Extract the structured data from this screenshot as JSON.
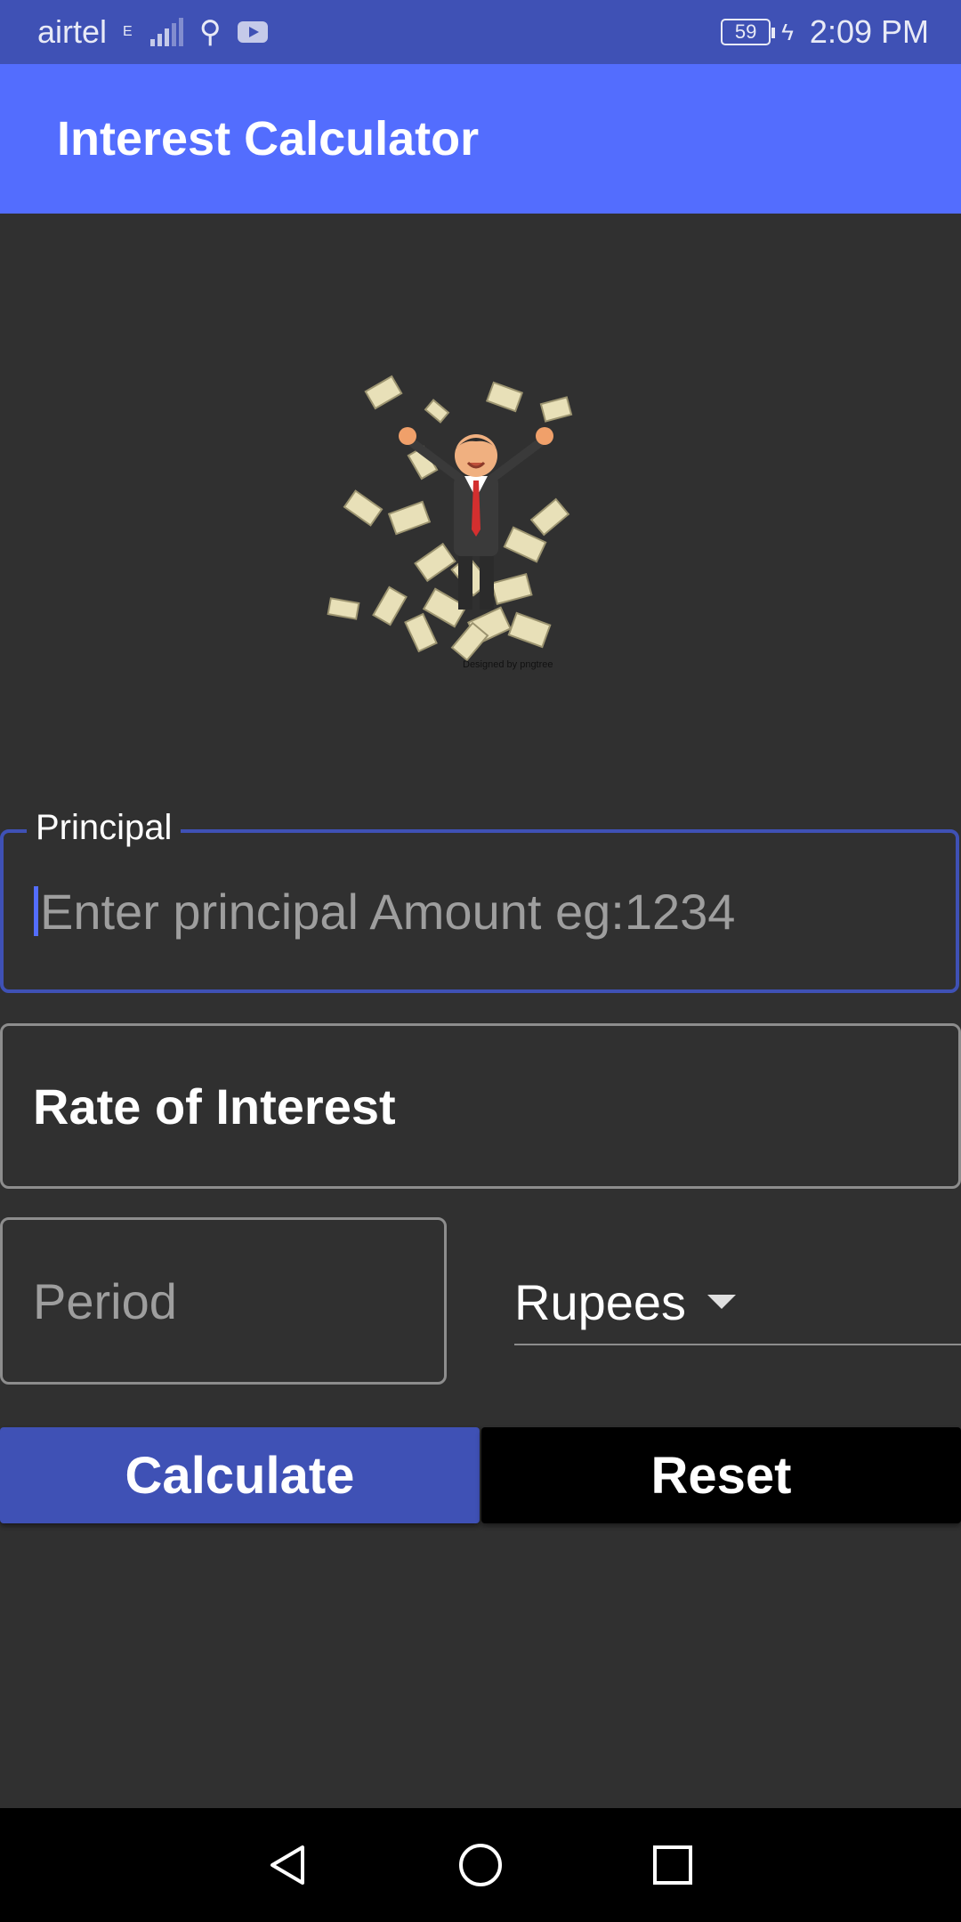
{
  "status_bar": {
    "carrier": "airtel",
    "network_type": "E",
    "battery_level": "59",
    "time": "2:09 PM",
    "icons": [
      "signal-icon",
      "usb-icon",
      "youtube-icon",
      "battery-icon",
      "charging-icon"
    ]
  },
  "app_bar": {
    "title": "Interest Calculator"
  },
  "hero_image": {
    "watermark": "Designed by pngtree"
  },
  "form": {
    "principal": {
      "label": "Principal",
      "placeholder": "Enter principal Amount eg:1234",
      "value": ""
    },
    "rate": {
      "value": "Rate of Interest"
    },
    "period": {
      "placeholder": "Period",
      "value": ""
    },
    "currency": {
      "selected": "Rupees"
    }
  },
  "buttons": {
    "calculate": "Calculate",
    "reset": "Reset"
  },
  "nav_bar": {
    "icons": [
      "back-icon",
      "home-icon",
      "recents-icon"
    ]
  },
  "colors": {
    "status_bar": "#3f51b5",
    "app_bar": "#536dfe",
    "background": "#303030",
    "primary": "#3f51b5",
    "reset_button": "#000000"
  }
}
